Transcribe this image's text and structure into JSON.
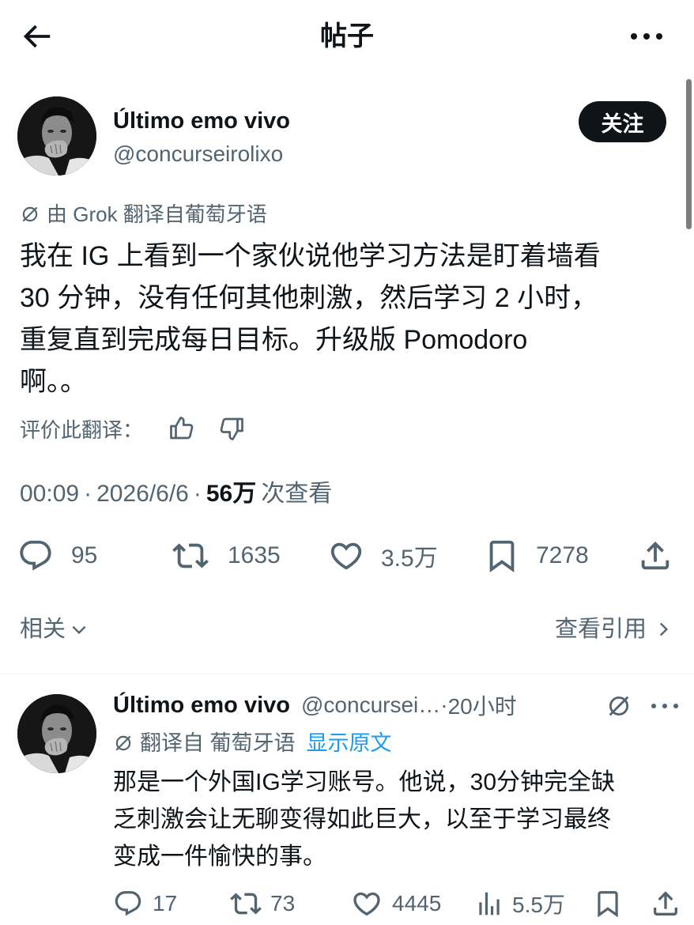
{
  "header": {
    "title": "帖子"
  },
  "post": {
    "author": {
      "name": "Último emo vivo",
      "handle": "@concurseirolixo"
    },
    "follow_label": "关注",
    "translation_note": "由 Grok 翻译自葡萄牙语",
    "text_lines": [
      "我在 IG 上看到一个家伙说他学习方法是盯着墙看",
      "30 分钟，没有任何其他刺激，然后学习 2 小时，",
      "重复直到完成每日目标。升级版 Pomodoro",
      "啊。。"
    ],
    "rate_translation_label": "评价此翻译：",
    "meta": {
      "time": "00:09",
      "sep": "·",
      "date": "2026/6/6",
      "views_count": "56万",
      "views_label": "次查看"
    },
    "stats": {
      "replies": "95",
      "reposts": "1635",
      "likes": "3.5万",
      "bookmarks": "7278"
    }
  },
  "related": {
    "label": "相关",
    "quotes_label": "查看引用"
  },
  "reply": {
    "author": {
      "name": "Último emo vivo",
      "handle": "@concursei…"
    },
    "sep": "·",
    "time": "20小时",
    "translation_note": "翻译自 葡萄牙语",
    "show_original_label": "显示原文",
    "text_lines": [
      "那是一个外国IG学习账号。他说，30分钟完全缺",
      "乏刺激会让无聊变得如此巨大，以至于学习最终",
      "变成一件愉快的事。"
    ],
    "stats": {
      "replies": "17",
      "reposts": "73",
      "likes": "4445",
      "views": "5.5万"
    }
  },
  "icons": {
    "back": "back-arrow-icon",
    "more": "more-dots-icon",
    "grok": "grok-icon",
    "reply": "reply-icon",
    "repost": "repost-icon",
    "like": "heart-icon",
    "bookmark": "bookmark-icon",
    "share": "share-icon",
    "views": "views-icon",
    "thumb_up": "thumbs-up-icon",
    "thumb_down": "thumbs-down-icon"
  },
  "colors": {
    "text": "#0f1419",
    "secondary": "#536471",
    "link": "#1d9bf0",
    "follow_button": "#0f1419",
    "divider": "#eff3f4"
  }
}
